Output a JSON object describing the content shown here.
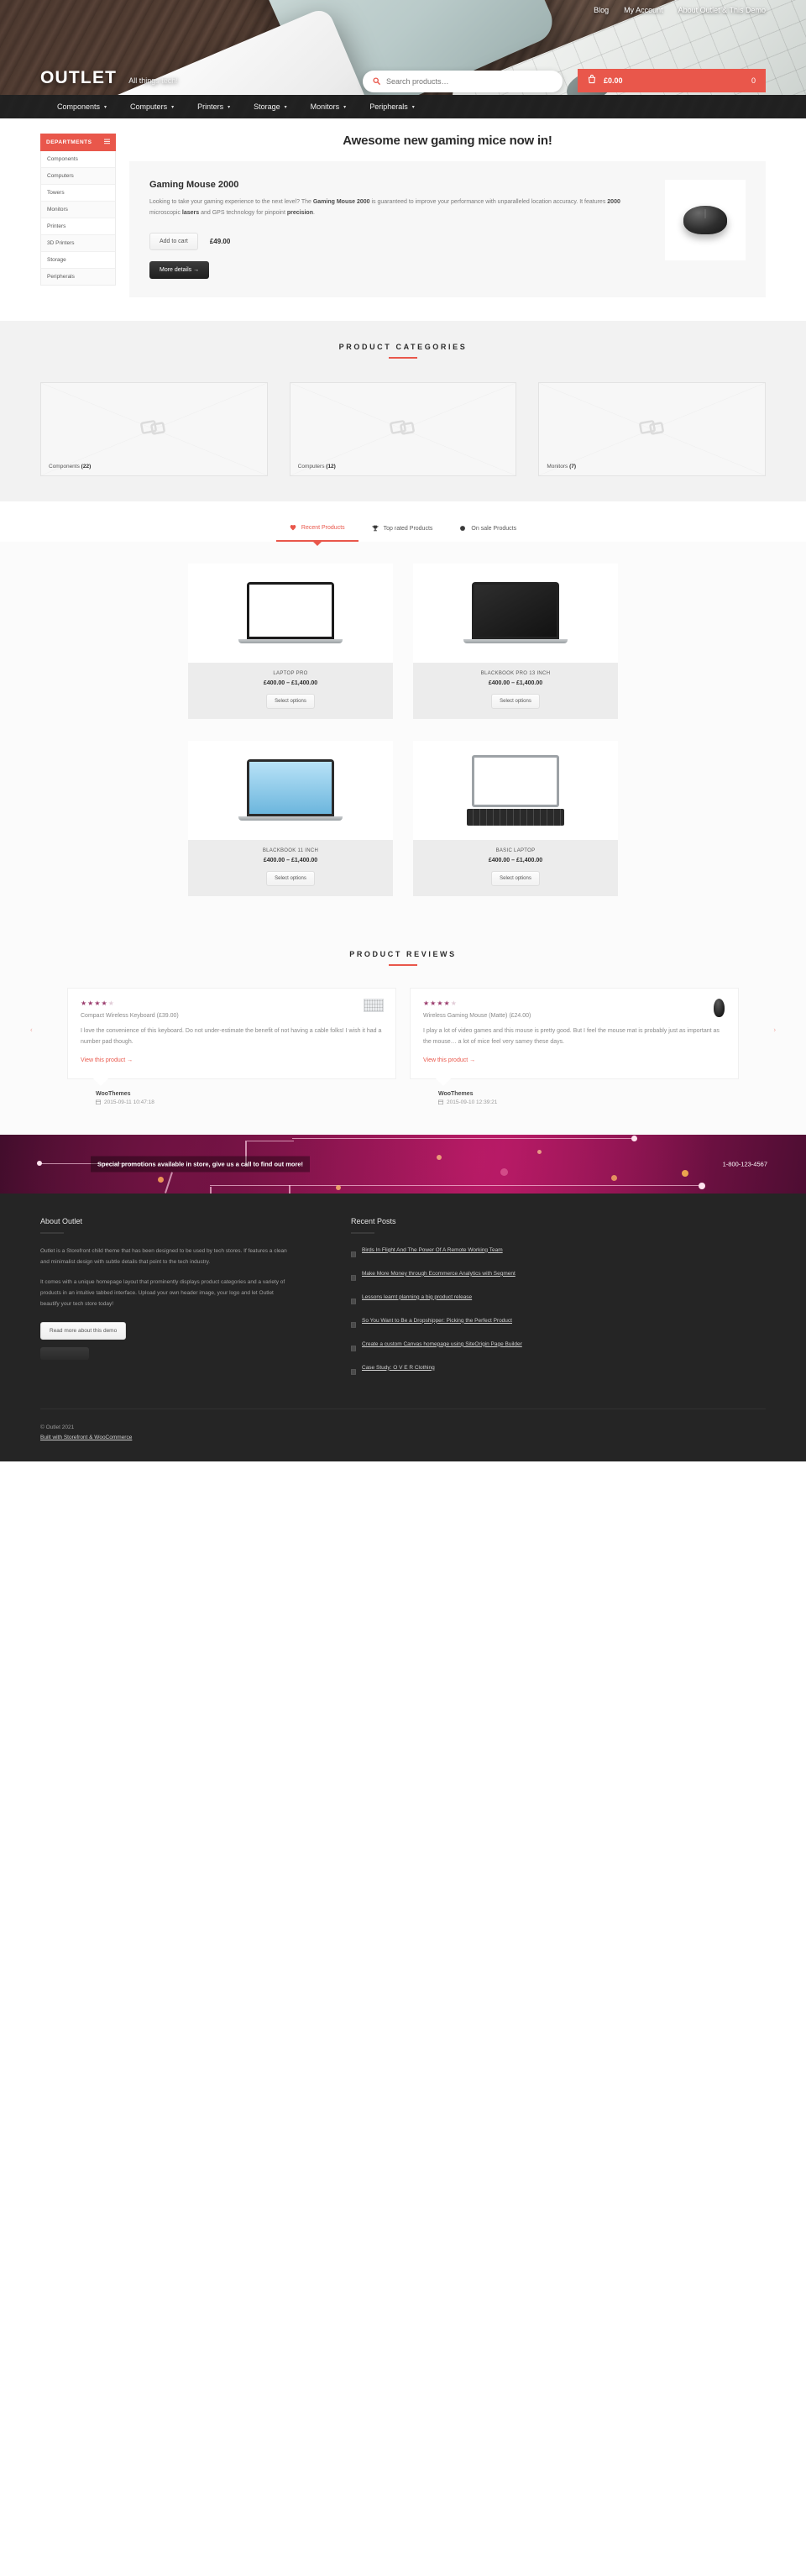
{
  "header": {
    "top_links": [
      {
        "label": "Blog"
      },
      {
        "label": "My Account"
      },
      {
        "label": "About Outlet & This Demo"
      }
    ],
    "logo": "OUTLET",
    "tagline": "All things tech!",
    "search": {
      "placeholder": "Search products…",
      "value": "",
      "icon": "search-icon"
    },
    "cart": {
      "amount": "£0.00",
      "count": "0",
      "icon": "cart-icon"
    }
  },
  "nav": {
    "items": [
      {
        "label": "Components",
        "has_dropdown": true
      },
      {
        "label": "Computers",
        "has_dropdown": true
      },
      {
        "label": "Printers",
        "has_dropdown": true
      },
      {
        "label": "Storage",
        "has_dropdown": true
      },
      {
        "label": "Monitors",
        "has_dropdown": true
      },
      {
        "label": "Peripherals",
        "has_dropdown": true
      }
    ],
    "caret": "▾"
  },
  "departments": {
    "title": "DEPARTMENTS",
    "icon": "list-icon",
    "items": [
      {
        "label": "Components"
      },
      {
        "label": "Computers"
      },
      {
        "label": "Towers"
      },
      {
        "label": "Monitors"
      },
      {
        "label": "Printers"
      },
      {
        "label": "3D Printers"
      },
      {
        "label": "Storage"
      },
      {
        "label": "Peripherals"
      }
    ]
  },
  "hero": {
    "title": "Awesome new gaming mice now in!",
    "product_name": "Gaming Mouse 2000",
    "desc_1": "Looking to take your gaming experience to the next level? The ",
    "desc_b1": "Gaming Mouse 2000",
    "desc_2": " is guaranteed to improve your performance with unparalleled location accuracy. It features ",
    "desc_b2": "2000",
    "desc_3": " microscopic ",
    "desc_b3": "lasers",
    "desc_4": " and GPS technology for pinpoint ",
    "desc_b4": "precision",
    "desc_5": ".",
    "add_to_cart": "Add to cart",
    "price": "£49.00",
    "more_details": "More details →",
    "image": "gaming-mouse-image"
  },
  "categories": {
    "title": "PRODUCT CATEGORIES",
    "items": [
      {
        "label": "Components",
        "count": "(22)"
      },
      {
        "label": "Computers",
        "count": "(12)"
      },
      {
        "label": "Monitors",
        "count": "(7)"
      }
    ]
  },
  "tabs": [
    {
      "label": "Recent Products",
      "icon": "heart-icon",
      "active": true
    },
    {
      "label": "Top rated Products",
      "icon": "trophy-icon",
      "active": false
    },
    {
      "label": "On sale Products",
      "icon": "tag-icon",
      "active": false
    }
  ],
  "products": [
    {
      "name": "LAPTOP PRO",
      "price": "£400.00 – £1,400.00",
      "button": "Select options",
      "style": "lap-white"
    },
    {
      "name": "BLACKBOOK PRO 13 INCH",
      "price": "£400.00 – £1,400.00",
      "button": "Select options",
      "style": "lap-black"
    },
    {
      "name": "BLACKBOOK 11 INCH",
      "price": "£400.00 – £1,400.00",
      "button": "Select options",
      "style": "lap-blue"
    },
    {
      "name": "BASIC LAPTOP",
      "price": "£400.00 – £1,400.00",
      "button": "Select options",
      "style": "lap-basic"
    }
  ],
  "reviews": {
    "title": "PRODUCT REVIEWS",
    "arrow_left": "‹",
    "arrow_right": "›",
    "items": [
      {
        "stars_on": 4,
        "stars_off": 1,
        "product": "Compact Wireless Keyboard",
        "product_price": "(£39.00)",
        "body": "I love the convenience of this keyboard. Do not under-estimate the benefit of not having a cable folks! I wish it had a number pad though.",
        "link": "View this product →",
        "author": "WooThemes",
        "date": "2015-09-11 10:47:18",
        "thumb": "keyboard-thumb"
      },
      {
        "stars_on": 4,
        "stars_off": 1,
        "product": "Wireless Gaming Mouse (Matte)",
        "product_price": "(£24.00)",
        "body": "I play a lot of video games and this mouse is pretty good. But I feel the mouse mat is probably just as important as the mouse… a lot of mice feel very samey these days.",
        "link": "View this product →",
        "author": "WooThemes",
        "date": "2015-09-10 12:39:21",
        "thumb": "mouse-thumb"
      }
    ]
  },
  "promo": {
    "text": "Special promotions available in store, give us a call to find out more!",
    "phone": "1-800-123-4567"
  },
  "footer": {
    "about": {
      "heading": "About Outlet",
      "p1": "Outlet is a Storefront child theme that has been designed to be used by tech stores. If features a clean and minimalist design with subtle details that point to the tech industry.",
      "p2": "It comes with a unique homepage layout that prominently displays product categories and a variety of products in an intuitive tabbed interface. Upload your own header image, your logo and let Outlet beautify your tech store today!",
      "button": "Read more about this demo"
    },
    "posts": {
      "heading": "Recent Posts",
      "items": [
        {
          "label": "Birds In Flight And The Power Of A Remote Working Team"
        },
        {
          "label": "Make More Money through Ecommerce Analytics with Segment"
        },
        {
          "label": "Lessons learnt planning a big product release"
        },
        {
          "label": "So You Want to Be a Dropshipper: Picking the Perfect Product"
        },
        {
          "label": "Create a custom Canvas homepage using SiteOrigin Page Builder"
        },
        {
          "label": "Case Study: O V E R Clothing"
        }
      ]
    },
    "copyright": "© Outlet 2021",
    "built_with": "Built with Storefront & WooCommerce"
  },
  "colors": {
    "accent": "#e9574b",
    "dark": "#252525",
    "nav": "#2f2f2f"
  }
}
